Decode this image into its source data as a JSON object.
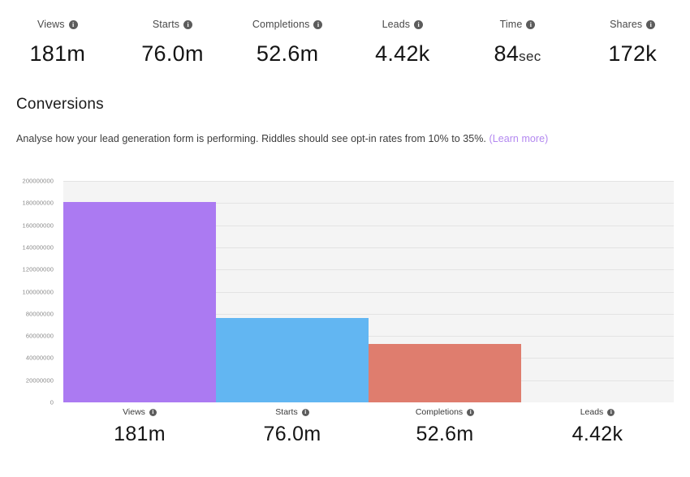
{
  "metrics": [
    {
      "label": "Views",
      "value": "181m",
      "unit": "",
      "icon": "info-icon"
    },
    {
      "label": "Starts",
      "value": "76.0m",
      "unit": "",
      "icon": "info-icon"
    },
    {
      "label": "Completions",
      "value": "52.6m",
      "unit": "",
      "icon": "info-icon"
    },
    {
      "label": "Leads",
      "value": "4.42k",
      "unit": "",
      "icon": "info-icon"
    },
    {
      "label": "Time",
      "value": "84",
      "unit": "sec",
      "icon": "info-icon"
    },
    {
      "label": "Shares",
      "value": "172k",
      "unit": "",
      "icon": "info-icon"
    }
  ],
  "section": {
    "title": "Conversions",
    "desc_before": "Analyse how your lead generation form is performing. Riddles should see opt-in rates from 10% to 35%. ",
    "link_text": "(Learn more)"
  },
  "colors": {
    "views": "#ab7af2",
    "starts": "#62b6f2",
    "completions": "#df7d6e",
    "leads": "#7ed0b5",
    "link": "#b388f0",
    "plot_bg": "#f4f4f4",
    "gridline": "#e3e3e3"
  },
  "chart_data": {
    "type": "bar",
    "title": "Conversions",
    "xlabel": "",
    "ylabel": "",
    "categories": [
      "Views",
      "Starts",
      "Completions",
      "Leads"
    ],
    "values": [
      181000000,
      76000000,
      52600000,
      4420
    ],
    "display_values": [
      "181m",
      "76.0m",
      "52.6m",
      "4.42k"
    ],
    "colors": [
      "#ab7af2",
      "#62b6f2",
      "#df7d6e",
      "#7ed0b5"
    ],
    "ylim": [
      0,
      200000000
    ],
    "ytick_step": 20000000,
    "ytick_labels": [
      "200000000",
      "180000000",
      "160000000",
      "140000000",
      "120000000",
      "100000000",
      "80000000",
      "60000000",
      "40000000",
      "20000000",
      "0"
    ],
    "grid": true,
    "legend": false
  }
}
